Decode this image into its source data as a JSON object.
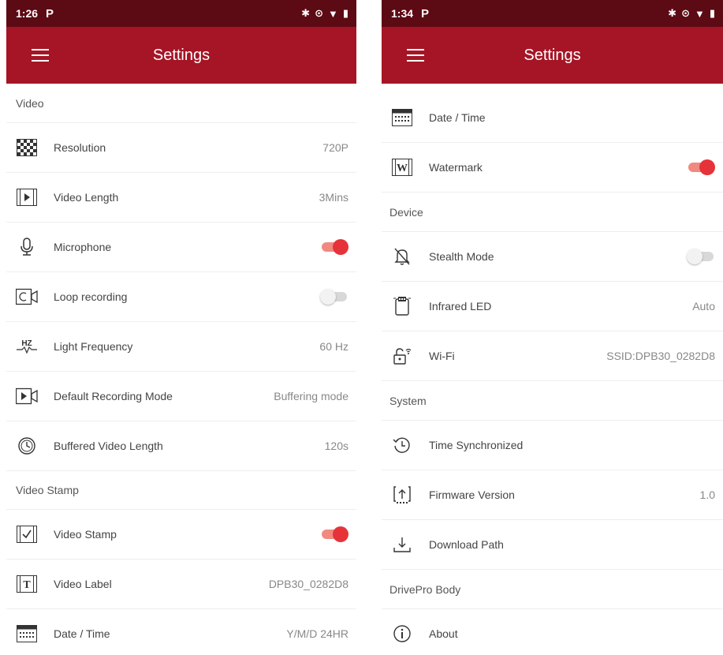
{
  "left": {
    "status_time": "1:26",
    "status_app": "P",
    "title": "Settings",
    "sections": {
      "video": "Video",
      "video_stamp": "Video Stamp"
    },
    "rows": {
      "resolution": {
        "label": "Resolution",
        "value": "720P"
      },
      "video_length": {
        "label": "Video Length",
        "value": "3Mins"
      },
      "microphone": {
        "label": "Microphone",
        "toggle": "on"
      },
      "loop_recording": {
        "label": "Loop recording",
        "toggle": "off"
      },
      "light_frequency": {
        "label": "Light Frequency",
        "value": "60 Hz"
      },
      "default_recording_mode": {
        "label": "Default Recording Mode",
        "value": "Buffering mode"
      },
      "buffered_video_length": {
        "label": "Buffered Video Length",
        "value": "120s"
      },
      "video_stamp": {
        "label": "Video Stamp",
        "toggle": "on"
      },
      "video_label": {
        "label": "Video Label",
        "value": "DPB30_0282D8"
      },
      "date_time": {
        "label": "Date / Time",
        "value": "Y/M/D 24HR"
      }
    }
  },
  "right": {
    "status_time": "1:34",
    "status_app": "P",
    "title": "Settings",
    "sections": {
      "device": "Device",
      "system": "System",
      "drivepro_body": "DrivePro Body"
    },
    "rows": {
      "date_time": {
        "label": "Date / Time"
      },
      "watermark": {
        "label": "Watermark",
        "toggle": "on"
      },
      "stealth_mode": {
        "label": "Stealth Mode",
        "toggle": "off"
      },
      "infrared_led": {
        "label": "Infrared LED",
        "value": "Auto"
      },
      "wifi": {
        "label": "Wi-Fi",
        "value": "SSID:DPB30_0282D8"
      },
      "time_synchronized": {
        "label": "Time Synchronized"
      },
      "firmware_version": {
        "label": "Firmware Version",
        "value": "1.0"
      },
      "download_path": {
        "label": "Download Path"
      },
      "about": {
        "label": "About"
      }
    }
  },
  "icons": {
    "hz_glyph": "HZ",
    "watermark_glyph": "W",
    "label_glyph": "T"
  },
  "colors": {
    "status_bar": "#5c0a14",
    "app_bar": "#a51525",
    "toggle_on": "#e6333a"
  }
}
